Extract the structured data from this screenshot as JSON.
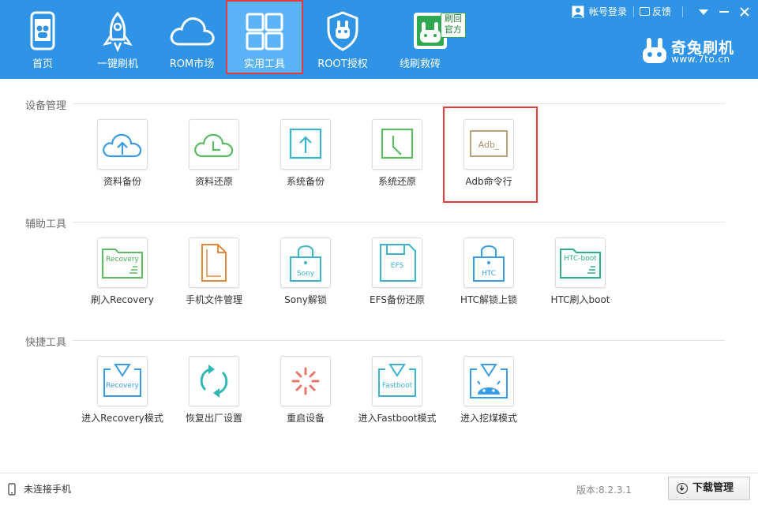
{
  "nav": {
    "items": [
      {
        "label": "首页",
        "icon": "phone-icon"
      },
      {
        "label": "一键刷机",
        "icon": "rocket-icon"
      },
      {
        "label": "ROM市场",
        "icon": "cloud-icon"
      },
      {
        "label": "实用工具",
        "icon": "grid-icon",
        "active": true
      },
      {
        "label": "ROOT授权",
        "icon": "shield-rabbit-icon"
      },
      {
        "label": "线刷救砖",
        "icon": "rabbit-card-icon",
        "badge": "刷回\n官方"
      }
    ]
  },
  "window_controls": {
    "account": "帐号登录",
    "feedback": "反馈"
  },
  "brand": {
    "name": "奇兔刷机",
    "url": "www.7to.cn"
  },
  "sections": [
    {
      "title": "设备管理",
      "tools": [
        {
          "label": "资料备份",
          "icon": "cloud-upload-icon"
        },
        {
          "label": "资料还原",
          "icon": "cloud-clock-icon"
        },
        {
          "label": "系统备份",
          "icon": "box-upload-icon"
        },
        {
          "label": "系统还原",
          "icon": "box-clock-icon"
        },
        {
          "label": "Adb命令行",
          "icon": "terminal-icon",
          "icon_text": "Adb_",
          "highlighted": true
        }
      ]
    },
    {
      "title": "辅助工具",
      "tools": [
        {
          "label": "刷入Recovery",
          "icon": "folder-recovery-icon",
          "icon_text": "Recovery"
        },
        {
          "label": "手机文件管理",
          "icon": "file-stack-icon"
        },
        {
          "label": "Sony解锁",
          "icon": "lock-sony-icon",
          "icon_text": "Sony"
        },
        {
          "label": "EFS备份还原",
          "icon": "floppy-efs-icon",
          "icon_text": "EFS"
        },
        {
          "label": "HTC解锁上锁",
          "icon": "lock-htc-icon",
          "icon_text": "HTC"
        },
        {
          "label": "HTC刷入boot",
          "icon": "folder-htcboot-icon",
          "icon_text": "HTC-boot"
        }
      ]
    },
    {
      "title": "快捷工具",
      "tools": [
        {
          "label": "进入Recovery模式",
          "icon": "recovery-mode-icon",
          "icon_text": "Recovery"
        },
        {
          "label": "恢复出厂设置",
          "icon": "refresh-icon"
        },
        {
          "label": "重启设备",
          "icon": "spinner-icon"
        },
        {
          "label": "进入Fastboot模式",
          "icon": "fastboot-mode-icon",
          "icon_text": "Fastboot"
        },
        {
          "label": "进入挖煤模式",
          "icon": "android-download-icon"
        }
      ]
    }
  ],
  "status": {
    "text": "未连接手机",
    "version": "版本:8.2.3.1",
    "download_button": "下载管理"
  },
  "colors": {
    "header": "#2f93e6",
    "active_tab": "#5bb3f5",
    "highlight": "#e23c3c"
  }
}
